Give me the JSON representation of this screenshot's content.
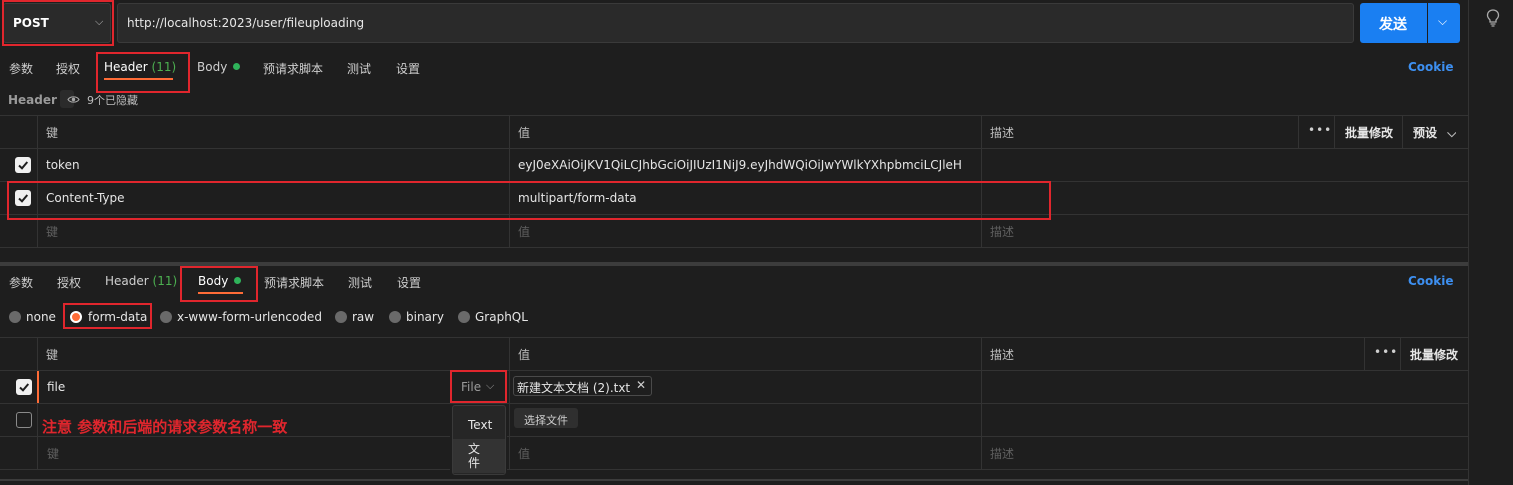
{
  "request": {
    "method": "POST",
    "url": "http://localhost:2023/user/fileuploading",
    "send_label": "发送"
  },
  "tabs": {
    "params": "参数",
    "auth": "授权",
    "header": "Header",
    "header_count": "(11)",
    "body": "Body",
    "pre_script": "预请求脚本",
    "tests": "测试",
    "settings": "设置",
    "cookie": "Cookie"
  },
  "header_section": {
    "label": "Header",
    "hidden_badge": "9个已隐藏",
    "columns": {
      "key": "键",
      "value": "值",
      "desc": "描述",
      "more": "•••",
      "bulk_edit": "批量修改",
      "presets": "预设"
    },
    "rows": [
      {
        "key": "token",
        "value": "eyJ0eXAiOiJKV1QiLCJhbGciOiJIUzI1NiJ9.eyJhdWQiOiJwYWlkYXhpbmciLCJleH",
        "checked": true
      },
      {
        "key": "Content-Type",
        "value": "multipart/form-data",
        "checked": true
      }
    ],
    "placeholder": {
      "key": "键",
      "value": "值",
      "desc": "描述"
    }
  },
  "body_section": {
    "modes": [
      "none",
      "form-data",
      "x-www-form-urlencoded",
      "raw",
      "binary",
      "GraphQL"
    ],
    "selected_mode": "form-data",
    "columns": {
      "key": "键",
      "value": "值",
      "desc": "描述",
      "more": "•••",
      "bulk_edit": "批量修改"
    },
    "row": {
      "key": "file",
      "type": "File",
      "file_name": "新建文本文档 (2).txt",
      "checked": true
    },
    "choose_file": "选择文件",
    "type_options": [
      "Text",
      "文件"
    ],
    "placeholder": {
      "key": "键",
      "value": "值",
      "desc": "描述"
    },
    "annotation": "注意 参数和后端的请求参数名称一致"
  },
  "colors": {
    "accent": "#ff6c37",
    "send_blue": "#1a7ff2",
    "cookie_blue": "#3d8ff0",
    "annotation_red": "#e0262d",
    "green_dot": "#2fb35a"
  }
}
